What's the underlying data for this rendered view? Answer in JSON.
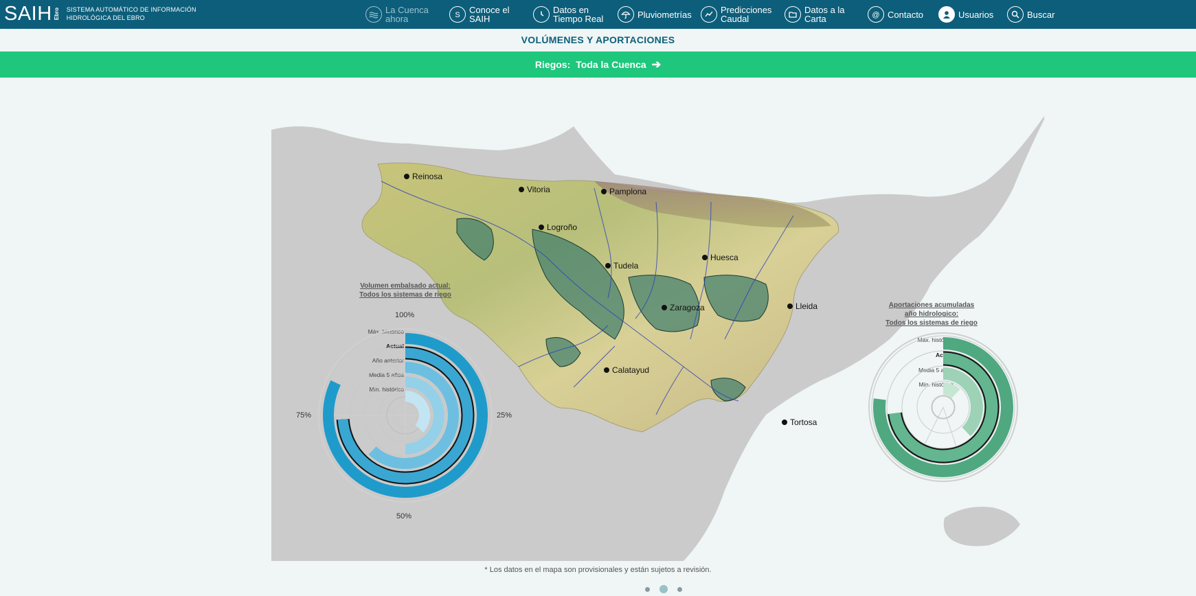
{
  "brand": {
    "name": "SAIH",
    "vertical": "Ebro",
    "subtitle_line1": "SISTEMA AUTOMÁTICO DE INFORMACIÓN",
    "subtitle_line2": "HIDROLÓGICA DEL EBRO"
  },
  "nav": [
    {
      "line1": "La Cuenca",
      "line2": "ahora",
      "icon": "waves-icon",
      "active": true
    },
    {
      "line1": "Conoce el",
      "line2": "SAIH",
      "icon": "saih-s-icon"
    },
    {
      "line1": "Datos en",
      "line2": "Tiempo Real",
      "icon": "clock-icon"
    },
    {
      "line1": "Pluviometrías",
      "line2": "",
      "icon": "umbrella-icon"
    },
    {
      "line1": "Predicciones",
      "line2": "Caudal",
      "icon": "chart-line-icon"
    },
    {
      "line1": "Datos a la",
      "line2": "Carta",
      "icon": "folder-icon"
    },
    {
      "line1": "Contacto",
      "line2": "",
      "icon": "at-icon"
    },
    {
      "line1": "Usuarios",
      "line2": "",
      "icon": "user-icon"
    },
    {
      "line1": "Buscar",
      "line2": "",
      "icon": "search-icon"
    }
  ],
  "page_title": "VOLÚMENES Y APORTACIONES",
  "filter": {
    "label": "Riegos:",
    "value": "Toda la Cuenca"
  },
  "cities": [
    "Reinosa",
    "Vitoria",
    "Pamplona",
    "Logroño",
    "Tudela",
    "Huesca",
    "Zaragoza",
    "Lleida",
    "Calatayud",
    "Tortosa"
  ],
  "chart_data": [
    {
      "type": "radial-bar",
      "title_line1": "Volumen embalsado actual:",
      "title_line2": "Todos los sistemas de riego",
      "ticks": [
        "100%",
        "25%",
        "50%",
        "75%"
      ],
      "categories": [
        "Máx. histórico",
        "Actual",
        "Año anterior",
        "Media 5 años",
        "Mín. histórico"
      ],
      "values": [
        82,
        74,
        62,
        50,
        37
      ],
      "highlight": "Actual",
      "colors": [
        "#1f9bcb",
        "#3aa7d2",
        "#6cbfe0",
        "#95d0e9",
        "#c3e5f3"
      ]
    },
    {
      "type": "radial-bar",
      "title_line1": "Aportaciones acumuladas",
      "title_line2": "año hidrologico:",
      "title_line3": "Todos los sistemas de riego",
      "categories": [
        "Máx. histórico",
        "Actual",
        "Media 5 años",
        "Mín. histórico"
      ],
      "values": [
        77,
        73,
        38,
        12
      ],
      "highlight": "Actual",
      "colors": [
        "#4fa87f",
        "#63b68f",
        "#9dd2b6",
        "#c5e6d3"
      ]
    }
  ],
  "footnote": "* Los datos en el mapa son provisionales y están sujetos a revisión.",
  "pager": {
    "count": 3,
    "active": 1
  }
}
